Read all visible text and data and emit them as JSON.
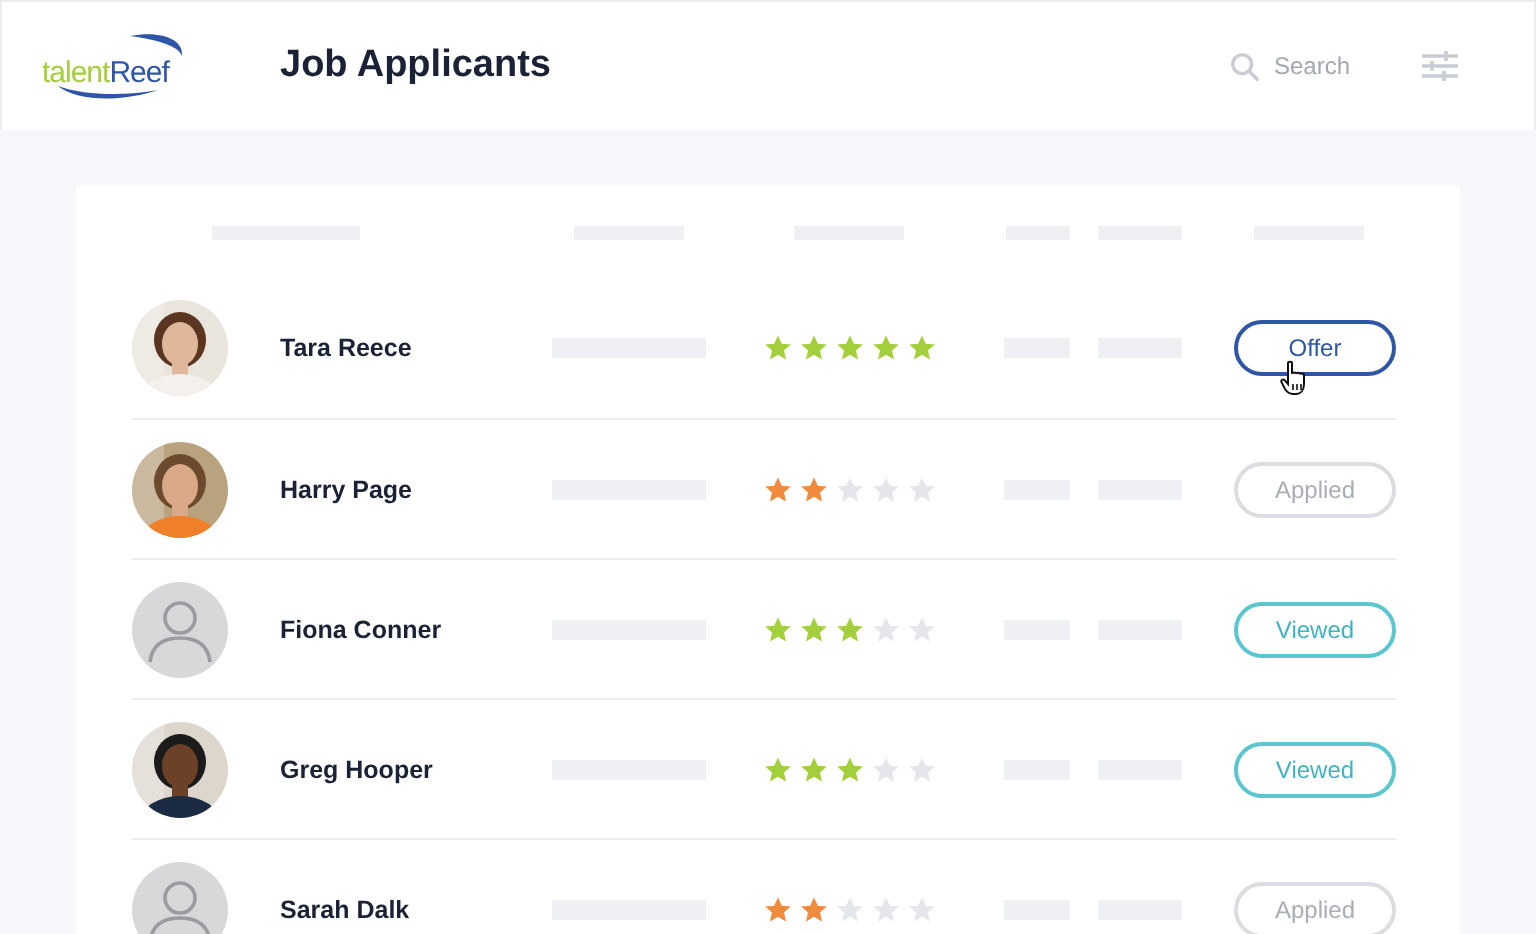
{
  "logo": {
    "prefix": "talent",
    "suffix": "Reef"
  },
  "title": "Job Applicants",
  "search": {
    "placeholder": "Search"
  },
  "applicants": [
    {
      "name": "Tara Reece",
      "stars": 5,
      "color": "#a4cf3c",
      "status": {
        "kind": "offer",
        "label": "Offer"
      },
      "hovered": true
    },
    {
      "name": "Harry Page",
      "stars": 2,
      "color": "#f08a3c",
      "status": {
        "kind": "applied",
        "label": "Applied"
      },
      "hovered": false
    },
    {
      "avatar": {
        "kind": "placeholder"
      },
      "name": "Fiona Conner",
      "stars": 3,
      "color": "#a4cf3c",
      "status": {
        "kind": "viewed",
        "label": "Viewed"
      },
      "hovered": false
    },
    {
      "name": "Greg Hooper",
      "stars": 3,
      "color": "#a4cf3c",
      "status": {
        "kind": "viewed",
        "label": "Viewed"
      },
      "hovered": false
    },
    {
      "avatar": {
        "kind": "placeholder"
      },
      "name": "Sarah Dalk",
      "stars": 2,
      "color": "#f08a3c",
      "status": {
        "kind": "applied",
        "label": "Applied"
      },
      "hovered": false
    }
  ]
}
